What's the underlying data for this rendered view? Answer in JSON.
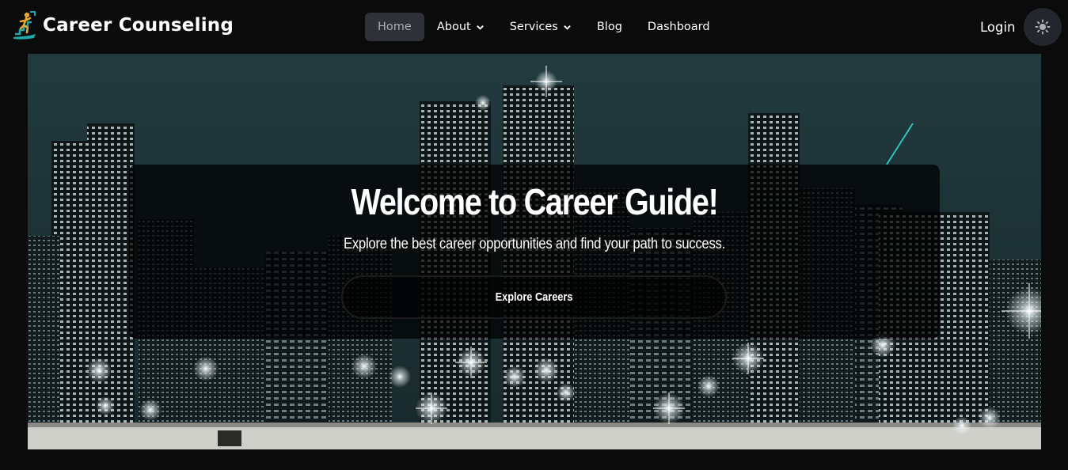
{
  "brand": {
    "name": "Career Counseling",
    "logo_icon": "career-climb-logo-icon"
  },
  "nav": {
    "items": [
      {
        "label": "Home",
        "active": true,
        "dropdown": false
      },
      {
        "label": "About",
        "active": false,
        "dropdown": true
      },
      {
        "label": "Services",
        "active": false,
        "dropdown": true
      },
      {
        "label": "Blog",
        "active": false,
        "dropdown": false
      },
      {
        "label": "Dashboard",
        "active": false,
        "dropdown": false
      }
    ],
    "login_label": "Login",
    "theme_icon": "sun-icon"
  },
  "hero": {
    "title": "Welcome to Career Guide!",
    "subtitle": "Explore the best career opportunities and find your path to success.",
    "cta_label": "Explore Careers",
    "background": "night-city-skyline-image"
  },
  "colors": {
    "background": "#0b0b0b",
    "text": "#ffffff",
    "nav_active_bg": "#2e3138",
    "nav_active_text": "#a9adb8",
    "theme_button_bg": "#23262c",
    "logo_teal": "#1fa8a8",
    "logo_gold": "#e8a530"
  }
}
